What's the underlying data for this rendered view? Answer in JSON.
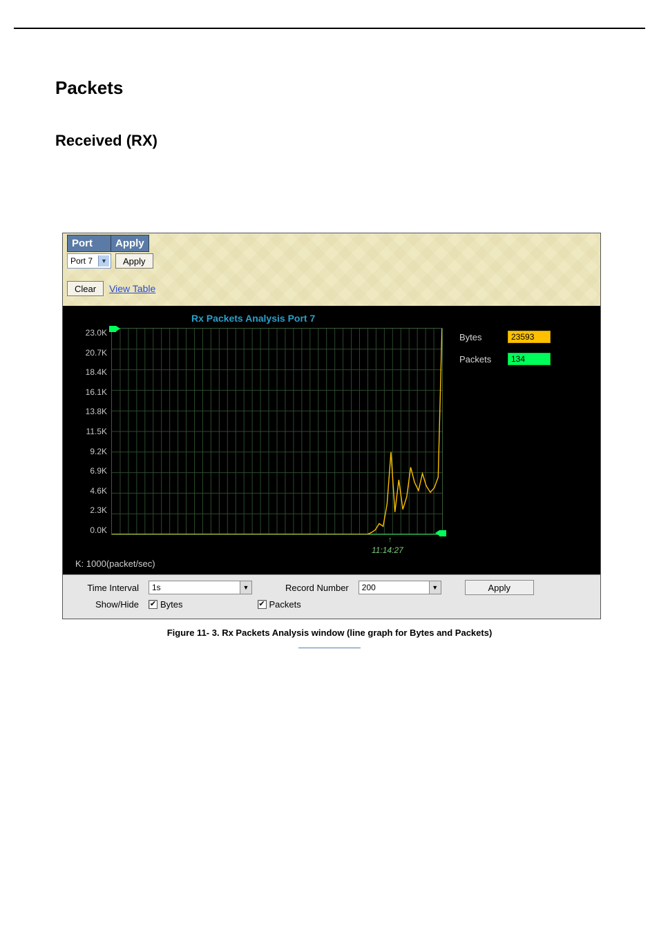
{
  "headings": {
    "packets": "Packets",
    "received": "Received (RX)"
  },
  "controls": {
    "port_header": "Port",
    "apply_header": "Apply",
    "port_value": "Port 7",
    "apply_btn": "Apply",
    "clear_btn": "Clear",
    "view_table": "View Table"
  },
  "chart_data": {
    "type": "line",
    "title": "Rx Packets Analysis  Port 7",
    "ylabel": "",
    "ylim": [
      0,
      23000
    ],
    "y_ticks": [
      "23.0K",
      "20.7K",
      "18.4K",
      "16.1K",
      "13.8K",
      "11.5K",
      "9.2K",
      "6.9K",
      "4.6K",
      "2.3K",
      "0.0K"
    ],
    "time_marker": "11:14:27",
    "unit_note": "K: 1000(packet/sec)",
    "series": [
      {
        "name": "Bytes",
        "color": "#ffc000",
        "current": 23593
      },
      {
        "name": "Packets",
        "color": "#00ff5a",
        "current": 134
      }
    ],
    "bytes_trace_y": [
      0,
      0,
      0,
      0,
      0,
      0,
      0,
      0,
      0,
      0,
      0,
      0,
      0,
      0,
      0,
      0,
      0,
      0,
      0,
      0,
      0,
      0,
      0,
      0,
      0,
      0,
      0,
      0,
      0,
      0,
      0,
      0,
      0,
      0,
      0,
      0,
      0,
      0,
      0,
      0,
      0,
      0,
      0,
      0,
      0,
      0,
      0,
      0,
      0,
      0,
      0,
      0,
      0,
      0,
      0,
      0,
      0,
      0,
      0,
      0,
      0,
      0,
      0,
      0,
      0,
      0,
      200,
      500,
      1200,
      900,
      3400,
      9200,
      2500,
      6100,
      2800,
      4200,
      7500,
      5800,
      4900,
      6800,
      5400,
      4700,
      5200,
      6400,
      23593
    ],
    "packets_trace_y": [
      0,
      0,
      0,
      0,
      0,
      0,
      0,
      0,
      0,
      0,
      0,
      0,
      0,
      0,
      0,
      0,
      0,
      0,
      0,
      0,
      0,
      0,
      0,
      0,
      0,
      0,
      0,
      0,
      0,
      0,
      0,
      0,
      0,
      0,
      0,
      0,
      0,
      0,
      0,
      0,
      0,
      0,
      0,
      0,
      0,
      0,
      0,
      0,
      0,
      0,
      0,
      0,
      0,
      0,
      0,
      0,
      0,
      0,
      0,
      0,
      0,
      0,
      0,
      0,
      0,
      0,
      0,
      0,
      0,
      0,
      0,
      0,
      0,
      0,
      0,
      0,
      0,
      0,
      0,
      0,
      0,
      0,
      0,
      0,
      134
    ]
  },
  "bottom": {
    "time_interval_label": "Time Interval",
    "time_interval_value": "1s",
    "record_number_label": "Record Number",
    "record_number_value": "200",
    "apply_btn": "Apply",
    "showhide_label": "Show/Hide",
    "cb_bytes": "Bytes",
    "cb_packets": "Packets"
  },
  "caption": "Figure 11- 3. Rx Packets Analysis window (line graph for Bytes and Packets)"
}
